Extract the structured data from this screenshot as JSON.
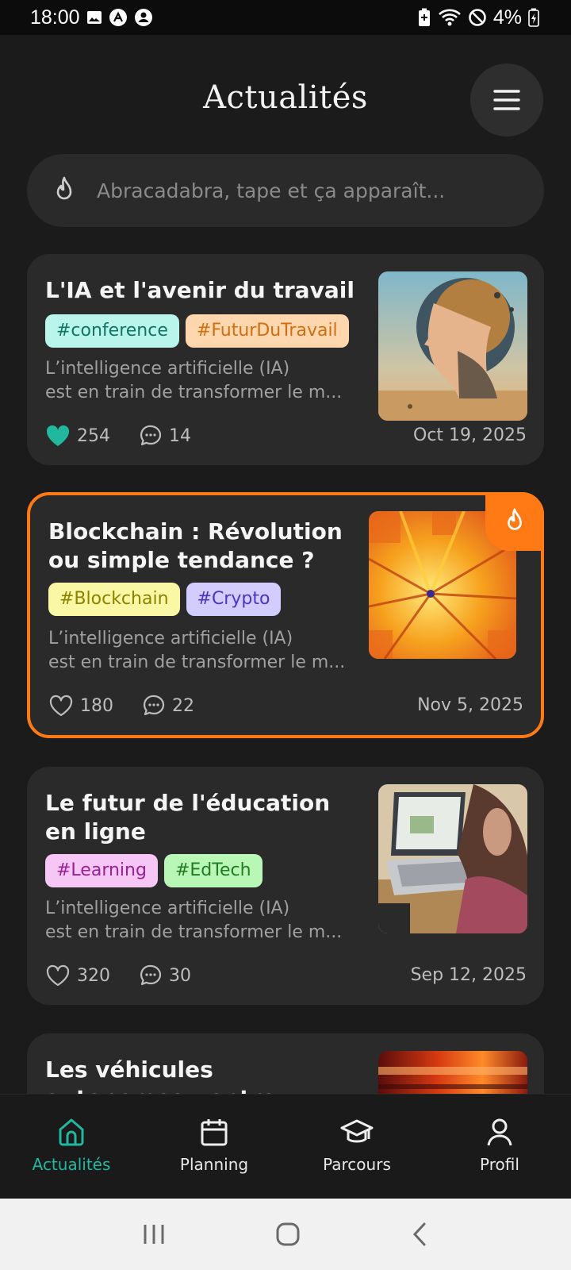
{
  "status_bar": {
    "time": "18:00",
    "battery": "4%"
  },
  "header": {
    "title": "Actualités"
  },
  "search": {
    "placeholder": "Abracadabra, tape et ça apparaît..."
  },
  "colors": {
    "accent": "#22b8a0",
    "hot": "#ff7a14",
    "card": "#2a2a2a",
    "background": "#1b1b1b"
  },
  "articles": [
    {
      "title": "L'IA et l'avenir du travail",
      "tags": [
        {
          "label": "#conference",
          "bg": "#b9f5ea",
          "fg": "#0f7566"
        },
        {
          "label": "#FuturDuTravail",
          "bg": "#ffd7ae",
          "fg": "#d06e12"
        }
      ],
      "excerpt_line1": "L’intelligence artificielle (IA)",
      "excerpt_line2": "est en train de transformer le m...",
      "likes": "254",
      "comments": "14",
      "date": "Oct 19, 2025",
      "liked": true,
      "hot": false
    },
    {
      "title": "Blockchain : Révolution ou simple tendance ?",
      "tags": [
        {
          "label": "#Blockchain",
          "bg": "#fbf8a5",
          "fg": "#8c8200"
        },
        {
          "label": "#Crypto",
          "bg": "#d2ccff",
          "fg": "#4c34c6"
        }
      ],
      "excerpt_line1": "L’intelligence artificielle (IA)",
      "excerpt_line2": "est en train de transformer le m...",
      "likes": "180",
      "comments": "22",
      "date": "Nov 5, 2025",
      "liked": false,
      "hot": true
    },
    {
      "title": "Le futur de l'éducation en ligne",
      "tags": [
        {
          "label": "#Learning",
          "bg": "#f6c6f4",
          "fg": "#9a2196"
        },
        {
          "label": "#EdTech",
          "bg": "#b9f7b6",
          "fg": "#217c21"
        }
      ],
      "excerpt_line1": "L’intelligence artificielle (IA)",
      "excerpt_line2": "est en train de transformer le m...",
      "likes": "320",
      "comments": "30",
      "date": "Sep 12, 2025",
      "liked": false,
      "hot": false
    },
    {
      "title": "Les véhicules autonomes : entre mythe et réalité"
    }
  ],
  "bottom_nav": [
    {
      "label": "Actualités",
      "icon": "home-icon",
      "active": true
    },
    {
      "label": "Planning",
      "icon": "calendar-icon",
      "active": false
    },
    {
      "label": "Parcours",
      "icon": "graduation-cap-icon",
      "active": false
    },
    {
      "label": "Profil",
      "icon": "user-icon",
      "active": false
    }
  ]
}
